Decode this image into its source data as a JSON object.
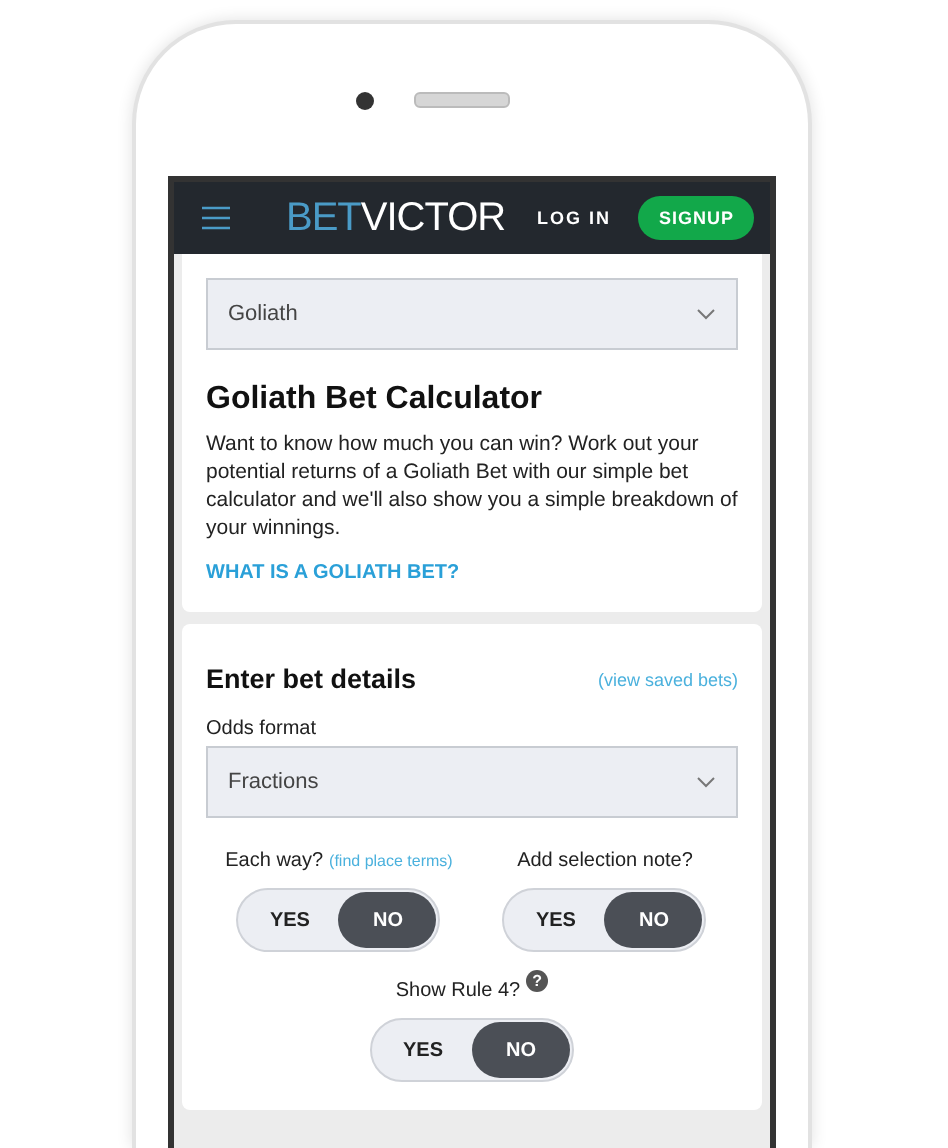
{
  "header": {
    "logo_left": "BET",
    "logo_right": "VICTOR",
    "login": "LOG IN",
    "signup": "SIGNUP"
  },
  "bet_type": {
    "value": "Goliath"
  },
  "intro": {
    "title": "Goliath Bet Calculator",
    "text": "Want to know how much you can win? Work out your potential returns of a Goliath Bet with our simple bet calculator and we'll also show you a simple breakdown of your winnings.",
    "link": "WHAT IS A GOLIATH BET?"
  },
  "details": {
    "title": "Enter bet details",
    "saved_link": "(view saved bets)",
    "odds_label": "Odds format",
    "odds_value": "Fractions",
    "toggles": [
      {
        "label": "Each way?",
        "link": "(find place terms)",
        "options": [
          {
            "label": "YES",
            "selected": false
          },
          {
            "label": "NO",
            "selected": true
          }
        ]
      },
      {
        "label": "Add selection note?",
        "options": [
          {
            "label": "YES",
            "selected": false
          },
          {
            "label": "NO",
            "selected": true
          }
        ]
      },
      {
        "label": "Show Rule 4?",
        "help": "?",
        "options": [
          {
            "label": "YES",
            "selected": false
          },
          {
            "label": "NO",
            "selected": true
          }
        ]
      }
    ]
  }
}
